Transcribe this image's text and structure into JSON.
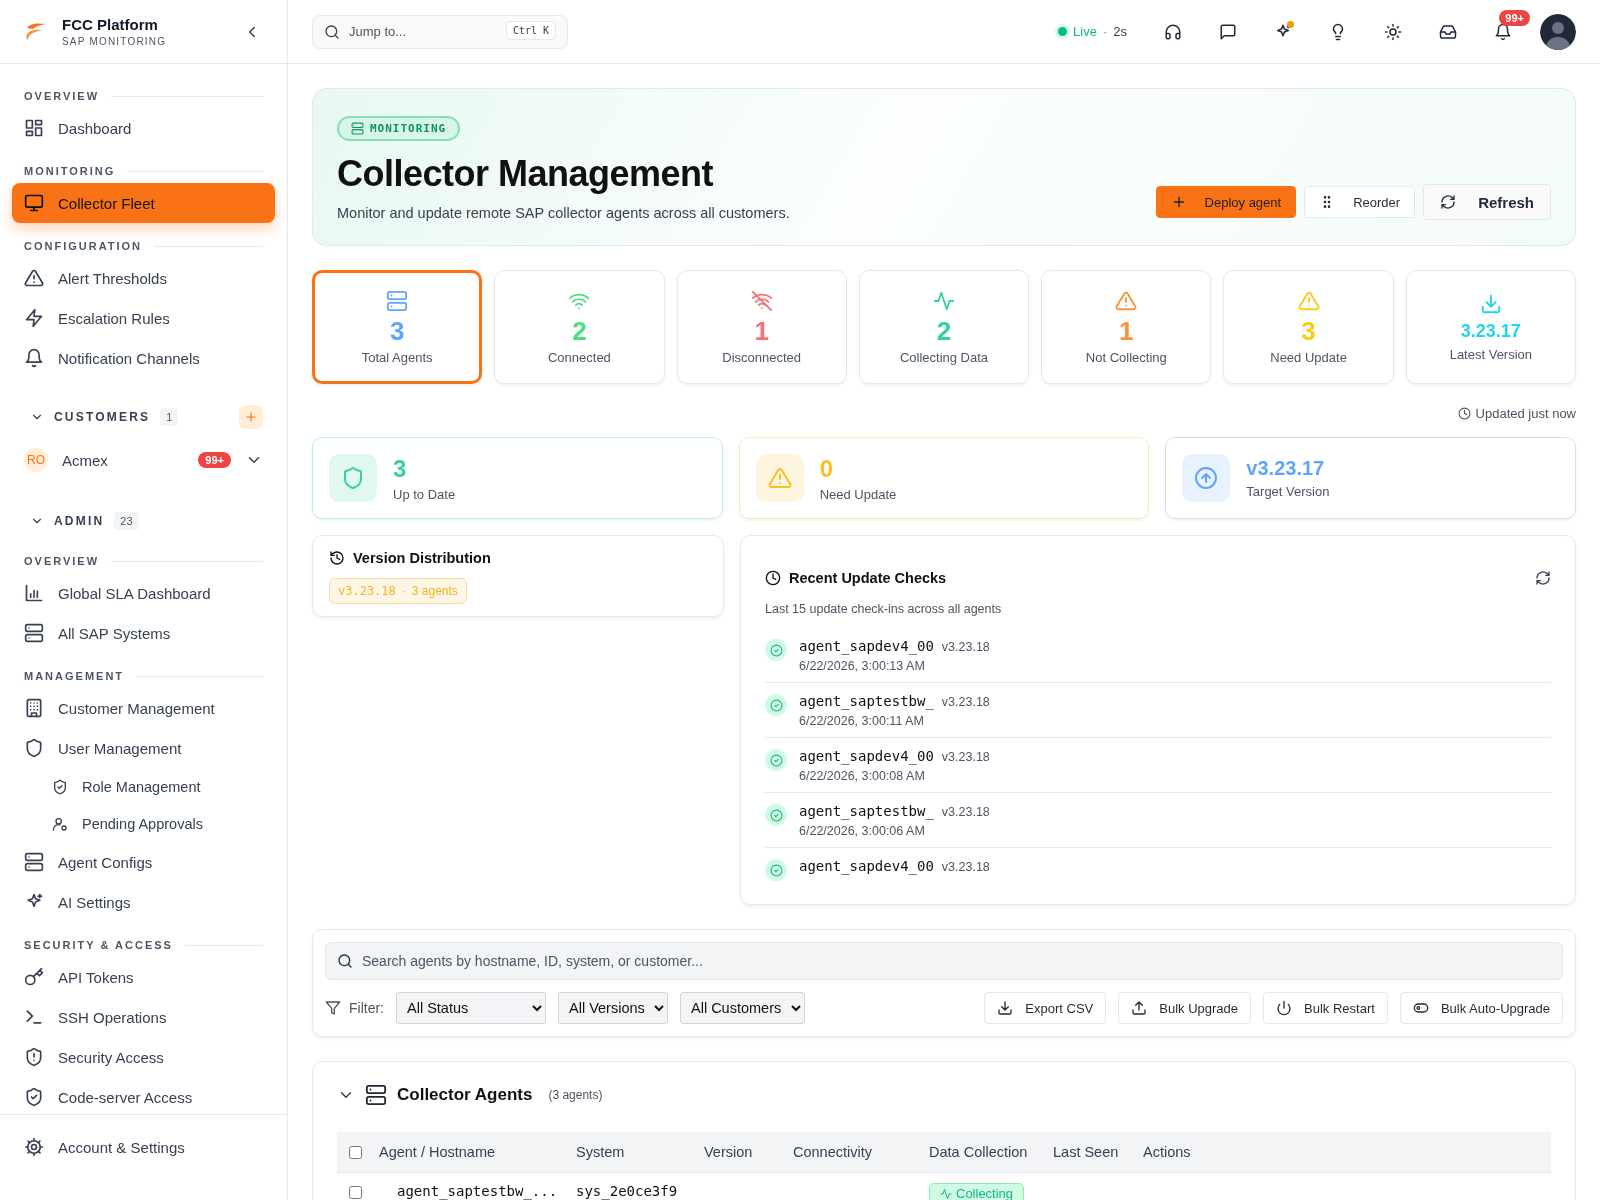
{
  "sidebar": {
    "brand": {
      "title": "FCC Platform",
      "subtitle": "SAP MONITORING"
    },
    "items": [
      {
        "kind": "heading",
        "label": "OVERVIEW"
      },
      {
        "kind": "item",
        "label": "Dashboard",
        "selected": false
      },
      {
        "kind": "heading",
        "label": "MONITORING"
      },
      {
        "kind": "item",
        "label": "Collector Fleet",
        "selected": true
      },
      {
        "kind": "heading",
        "label": "CONFIGURATION"
      },
      {
        "kind": "item",
        "label": "Alert Thresholds",
        "selected": false
      },
      {
        "kind": "item",
        "label": "Escalation Rules",
        "selected": false
      },
      {
        "kind": "item",
        "label": "Notification Channels",
        "selected": false
      },
      {
        "kind": "group",
        "label": "CUSTOMERS",
        "count": "1",
        "expanded": true,
        "add": true
      },
      {
        "kind": "customer",
        "initials": "RO",
        "label": "Acmex",
        "badge": "99+"
      },
      {
        "kind": "group",
        "label": "ADMIN",
        "count": "23",
        "expanded": true
      },
      {
        "kind": "heading",
        "label": "OVERVIEW"
      },
      {
        "kind": "item",
        "label": "Global SLA Dashboard",
        "selected": false
      },
      {
        "kind": "item",
        "label": "All SAP Systems",
        "selected": false
      },
      {
        "kind": "heading",
        "label": "MANAGEMENT"
      },
      {
        "kind": "item",
        "label": "Customer Management",
        "selected": false
      },
      {
        "kind": "item",
        "label": "User Management",
        "selected": false
      },
      {
        "kind": "subitem",
        "label": "Role Management",
        "selected": false
      },
      {
        "kind": "subitem",
        "label": "Pending Approvals",
        "selected": false
      },
      {
        "kind": "item",
        "label": "Agent Configs",
        "selected": false
      },
      {
        "kind": "item",
        "label": "AI Settings",
        "selected": false
      },
      {
        "kind": "heading",
        "label": "SECURITY & ACCESS"
      },
      {
        "kind": "item",
        "label": "API Tokens",
        "selected": false
      },
      {
        "kind": "item",
        "label": "SSH Operations",
        "selected": false
      },
      {
        "kind": "item",
        "label": "Security Access",
        "selected": false
      },
      {
        "kind": "item",
        "label": "Code-server Access",
        "selected": false
      }
    ],
    "footer": {
      "label": "Account & Settings"
    }
  },
  "topbar": {
    "search": {
      "placeholder": "Jump to...",
      "shortcut": "Ctrl K"
    },
    "live": {
      "label": "Live",
      "separator": "·",
      "interval": "2s"
    },
    "notifications": "99+"
  },
  "hero": {
    "tag": "MONITORING",
    "title": "Collector Management",
    "subtitle": "Monitor and update remote SAP collector agents across all customers.",
    "buttons": [
      {
        "label": "Deploy agent",
        "kind": "primary"
      },
      {
        "label": "Reorder",
        "kind": "plain"
      },
      {
        "label": "Refresh",
        "kind": "large"
      }
    ]
  },
  "stats": {
    "cards": [
      {
        "value": "3",
        "label": "Total Agents",
        "color": "#60a5fa",
        "selected": true
      },
      {
        "value": "2",
        "label": "Connected",
        "color": "#4ade80",
        "selected": false
      },
      {
        "value": "1",
        "label": "Disconnected",
        "color": "#f87171",
        "selected": false
      },
      {
        "value": "2",
        "label": "Collecting Data",
        "color": "#34d399",
        "selected": false
      },
      {
        "value": "1",
        "label": "Not Collecting",
        "color": "#fb923c",
        "selected": false
      },
      {
        "value": "3",
        "label": "Need Update",
        "color": "#facc15",
        "selected": false
      },
      {
        "value": "3.23.17",
        "label": "Latest Version",
        "color": "#22d3ee",
        "selected": false
      }
    ],
    "updated": "Updated just now"
  },
  "summary": [
    {
      "value": "3",
      "label": "Up to Date",
      "color": "#34d399"
    },
    {
      "value": "0",
      "label": "Need Update",
      "color": "#fbbf24"
    },
    {
      "value": "v3.23.17",
      "label": "Target Version",
      "color": "#60a5fa"
    }
  ],
  "version_distribution": {
    "title": "Version Distribution",
    "chips": [
      {
        "version": "v3.23.18",
        "separator": "·",
        "count": "3 agents"
      }
    ]
  },
  "recent_checks": {
    "title": "Recent Update Checks",
    "subtitle": "Last 15 update check-ins across all agents",
    "items": [
      {
        "agent": "agent_sapdev4_00",
        "version": "v3.23.18",
        "time": "6/22/2026, 3:00:13 AM"
      },
      {
        "agent": "agent_saptestbw_",
        "version": "v3.23.18",
        "time": "6/22/2026, 3:00:11 AM"
      },
      {
        "agent": "agent_sapdev4_00",
        "version": "v3.23.18",
        "time": "6/22/2026, 3:00:08 AM"
      },
      {
        "agent": "agent_saptestbw_",
        "version": "v3.23.18",
        "time": "6/22/2026, 3:00:06 AM"
      },
      {
        "agent": "agent_sapdev4_00",
        "version": "v3.23.18"
      }
    ]
  },
  "filters": {
    "search": {
      "placeholder": "Search agents by hostname, ID, system, or customer..."
    },
    "label": "Filter:",
    "selects": [
      "All Status",
      "All Versions",
      "All Customers"
    ],
    "buttons": [
      "Export CSV",
      "Bulk Upgrade",
      "Bulk Restart",
      "Bulk Auto-Upgrade"
    ]
  },
  "agents": {
    "title": "Collector Agents",
    "count": "(3 agents)",
    "expanded": true,
    "select_all_checked": false,
    "columns": [
      "Agent / Hostname",
      "System",
      "Version",
      "Connectivity",
      "Data Collection",
      "Last Seen",
      "Actions"
    ],
    "rows": [
      {
        "checked": false,
        "agent": "agent_saptestbw_...",
        "system": "sys_2e0ce3f9",
        "collection": "Collecting"
      }
    ]
  }
}
